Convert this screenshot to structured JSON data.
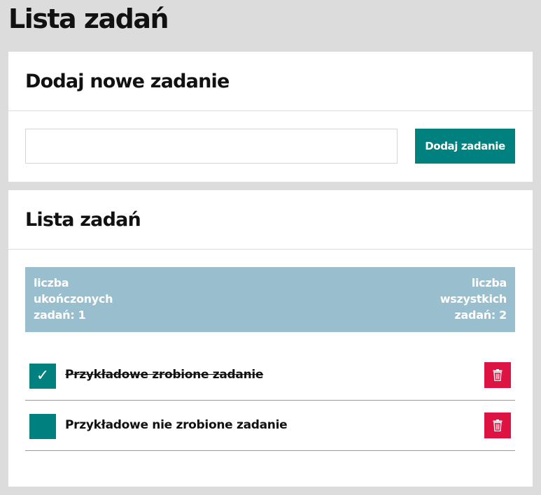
{
  "page": {
    "title": "Lista zadań"
  },
  "add_section": {
    "title": "Dodaj nowe zadanie",
    "input_value": "",
    "input_placeholder": "",
    "button_label": "Dodaj zadanie"
  },
  "list_section": {
    "title": "Lista zadań",
    "stats": {
      "completed": {
        "line1": "liczba",
        "line2": "ukończonych",
        "line3": "zadań: 1"
      },
      "total": {
        "line1": "liczba",
        "line2": "wszystkich",
        "line3": "zadań: 2"
      }
    },
    "tasks": [
      {
        "text": "Przykładowe zrobione zadanie",
        "done": true,
        "check_glyph": "✓"
      },
      {
        "text": "Przykładowe nie zrobione zadanie",
        "done": false,
        "check_glyph": ""
      }
    ]
  },
  "colors": {
    "background": "#dcdcdc",
    "accent_teal": "#00807f",
    "stats_blue": "#99bfcf",
    "delete_red": "#dd1343"
  },
  "icons": {
    "delete": "trash-icon",
    "check": "checkmark-icon"
  }
}
